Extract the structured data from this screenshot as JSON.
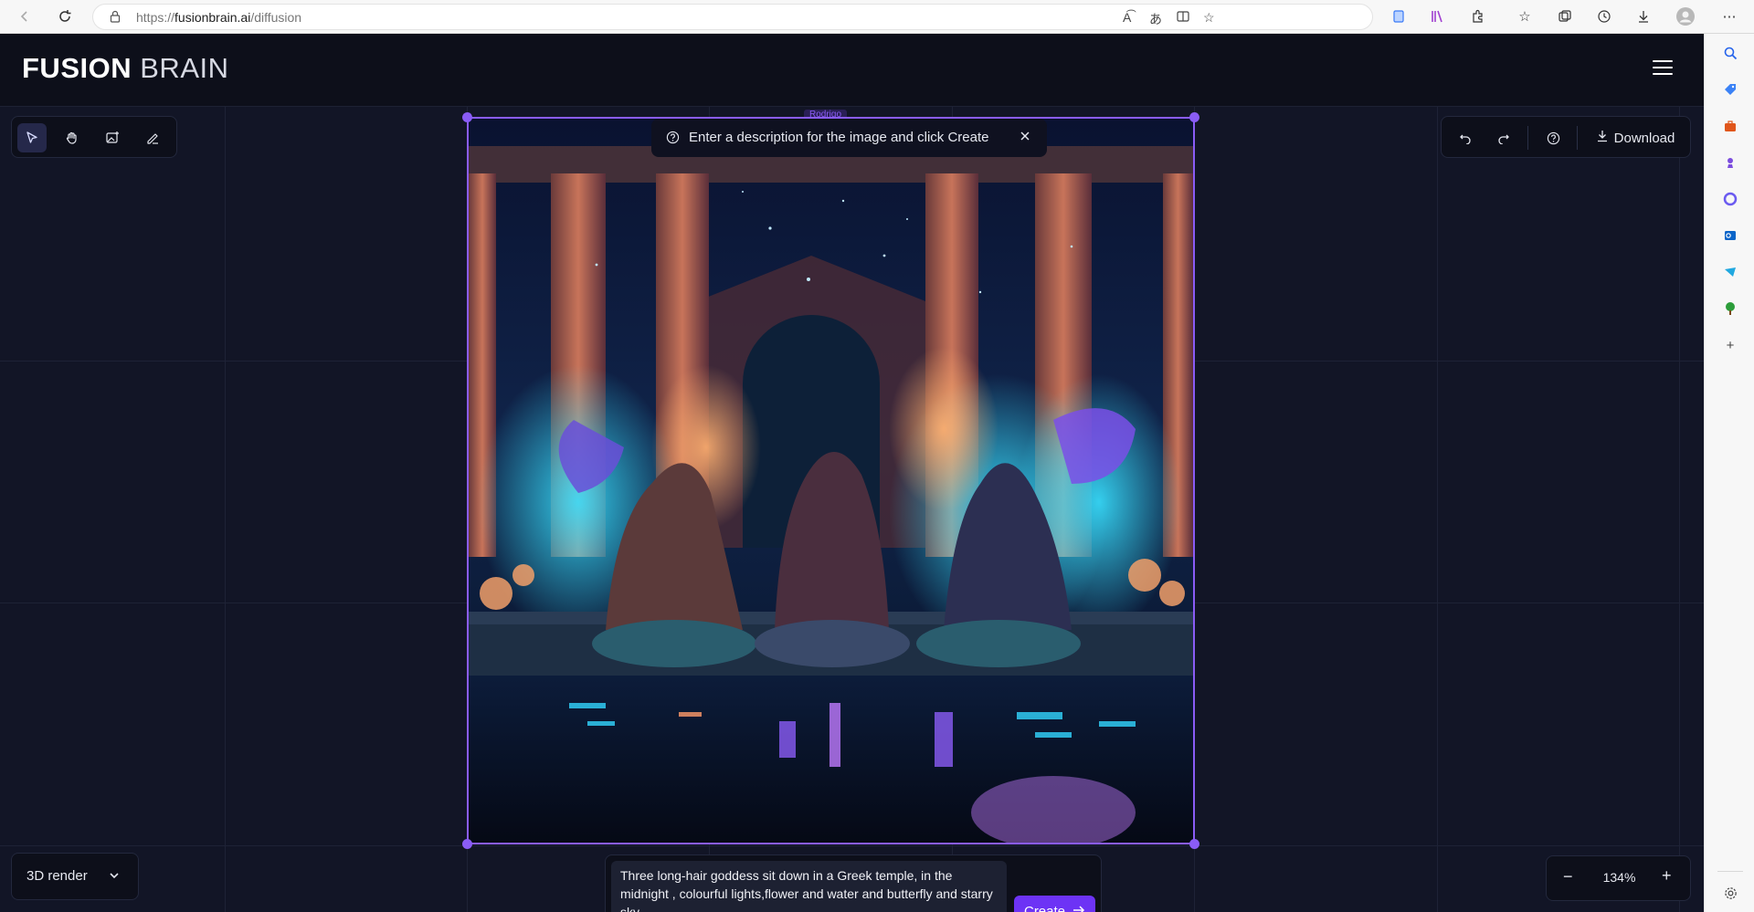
{
  "browser": {
    "url_prefix": "https://",
    "url_host": "fusionbrain.ai",
    "url_path": "/diffusion"
  },
  "app": {
    "logo_bold": "FUSION",
    "logo_light": "BRAIN"
  },
  "canvas": {
    "frame_tag": "Rodrigo",
    "hint": "Enter a description for the image and click Create",
    "download_label": "Download",
    "style_label": "3D render",
    "prompt_text": "Three long-hair goddess sit down in a Greek temple, in the midnight , colourful lights,flower and water and butterfly and starry sky",
    "create_label": "Create",
    "zoom_value": "134%",
    "zoom_minus": "−",
    "zoom_plus": "+"
  },
  "colors": {
    "accent": "#8a5cf6",
    "create_button": "#6d33f5",
    "background": "#10131f"
  }
}
